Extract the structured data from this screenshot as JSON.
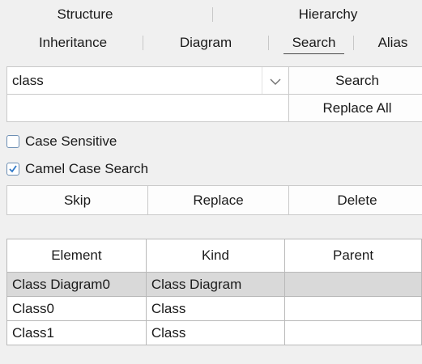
{
  "tabs_row1": [
    {
      "label": "Structure"
    },
    {
      "label": "Hierarchy"
    }
  ],
  "tabs_row2": [
    {
      "label": "Inheritance"
    },
    {
      "label": "Diagram"
    },
    {
      "label": "Search",
      "active": true
    },
    {
      "label": "Alias"
    }
  ],
  "search": {
    "query_value": "class",
    "replace_value": "",
    "search_button": "Search",
    "replace_all_button": "Replace All"
  },
  "options": {
    "case_sensitive": {
      "label": "Case Sensitive",
      "checked": false
    },
    "camel_case": {
      "label": "Camel Case Search",
      "checked": true
    }
  },
  "actions": {
    "skip": "Skip",
    "replace": "Replace",
    "delete": "Delete"
  },
  "results": {
    "columns": [
      "Element",
      "Kind",
      "Parent"
    ],
    "rows": [
      {
        "element": "Class Diagram0",
        "kind": "Class Diagram",
        "parent": "",
        "selected": true
      },
      {
        "element": "Class0",
        "kind": "Class",
        "parent": ""
      },
      {
        "element": "Class1",
        "kind": "Class",
        "parent": ""
      }
    ]
  }
}
